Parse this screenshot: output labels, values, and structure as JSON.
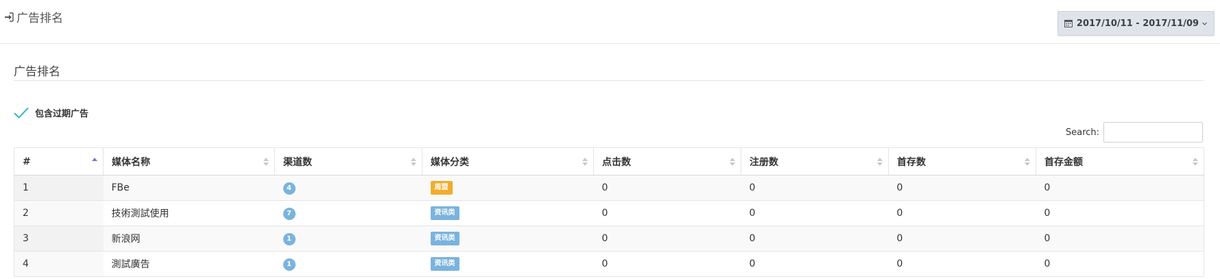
{
  "header": {
    "title": "广告排名",
    "date_range": "2017/10/11 - 2017/11/09"
  },
  "section": {
    "title": "广告排名",
    "include_expired_label": "包含过期广告"
  },
  "search": {
    "label": "Search:",
    "value": ""
  },
  "table": {
    "columns": [
      "#",
      "媒体名称",
      "渠道数",
      "媒体分类",
      "点击数",
      "注册数",
      "首存数",
      "首存金额"
    ],
    "rows": [
      {
        "idx": "1",
        "name": "FBe",
        "channels": "4",
        "category": "周盟",
        "category_color": "#f0ad2d",
        "clicks": "0",
        "registrations": "0",
        "first_deposits": "0",
        "first_deposit_amount": "0"
      },
      {
        "idx": "2",
        "name": "技術測試使用",
        "channels": "7",
        "category": "资讯类",
        "category_color": "#7ab3de",
        "clicks": "0",
        "registrations": "0",
        "first_deposits": "0",
        "first_deposit_amount": "0"
      },
      {
        "idx": "3",
        "name": "新浪网",
        "channels": "1",
        "category": "资讯类",
        "category_color": "#7ab3de",
        "clicks": "0",
        "registrations": "0",
        "first_deposits": "0",
        "first_deposit_amount": "0"
      },
      {
        "idx": "4",
        "name": "測試廣告",
        "channels": "1",
        "category": "资讯类",
        "category_color": "#7ab3de",
        "clicks": "0",
        "registrations": "0",
        "first_deposits": "0",
        "first_deposit_amount": "0"
      }
    ]
  },
  "colors": {
    "accent_check": "#3bb6c4",
    "badge": "#7ab3de",
    "sort_active": "#6a7fd0",
    "sort_inactive": "#c9c9c9"
  }
}
